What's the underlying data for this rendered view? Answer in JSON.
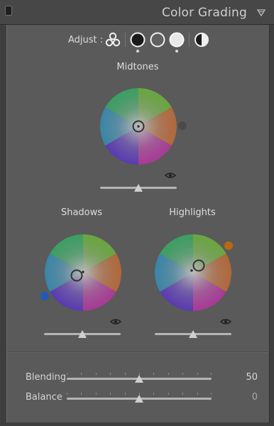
{
  "header": {
    "title": "Color Grading"
  },
  "adjust": {
    "label": "Adjust :",
    "modes": [
      {
        "name": "three-way-icon",
        "active": false
      },
      {
        "name": "shadows-mode-icon",
        "active": true
      },
      {
        "name": "midtones-mode-icon",
        "active": false
      },
      {
        "name": "highlights-mode-icon",
        "active": true
      },
      {
        "name": "global-mode-icon",
        "active": false
      }
    ]
  },
  "wheels": {
    "midtones": {
      "label": "Midtones",
      "luminance": 0.5
    },
    "shadows": {
      "label": "Shadows",
      "luminance": 0.5,
      "swatch_color": "#1f5bb5"
    },
    "highlights": {
      "label": "Highlights",
      "luminance": 0.5,
      "swatch_color": "#b86a10"
    }
  },
  "tuning": {
    "blending": {
      "label": "Blending",
      "value": "50",
      "fraction": 0.5
    },
    "balance": {
      "label": "Balance",
      "value": "0",
      "fraction": 0.5
    }
  }
}
